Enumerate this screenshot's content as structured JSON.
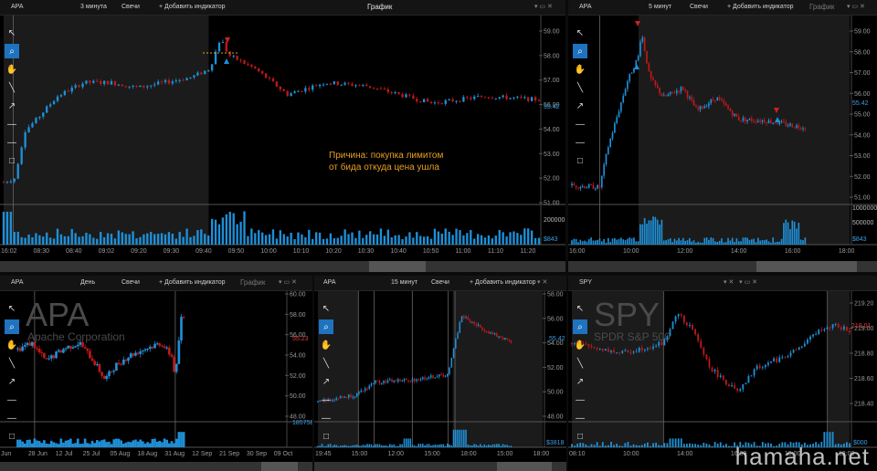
{
  "panels": {
    "p1": {
      "symbol": "APA",
      "interval": "3 минута",
      "ctype": "Свечи",
      "addind": "+ Добавить индикатор",
      "title": "График",
      "price": "55.42",
      "vol_label": "200000",
      "vol_last": "$843",
      "y": [
        "59.00",
        "58.00",
        "57.00",
        "56.00",
        "54.00",
        "53.00",
        "52.00",
        "51.00"
      ],
      "x": [
        "16:02",
        "08:30",
        "08:40",
        "09:02",
        "09:20",
        "09:30",
        "09:40",
        "09:50",
        "10:00",
        "10:10",
        "10:20",
        "10:30",
        "10:40",
        "10:50",
        "11:00",
        "11:10",
        "11:20"
      ]
    },
    "p2": {
      "symbol": "APA",
      "interval": "5 минут",
      "ctype": "Свечи",
      "addind": "+ Добавить индикатор",
      "title": "График",
      "price": "55.42",
      "vol_label": "1000000",
      "vol_label2": "500000",
      "vol_last": "$843",
      "y": [
        "59.00",
        "58.00",
        "57.00",
        "56.00",
        "55.00",
        "54.00",
        "53.00",
        "52.00",
        "51.00"
      ],
      "x": [
        "16:00",
        "10:00",
        "12:00",
        "14:00",
        "16:00",
        "18:00"
      ]
    },
    "p3": {
      "symbol": "APA",
      "interval": "День",
      "ctype": "Свечи",
      "addind": "+ Добавить индикатор",
      "title": "График",
      "big": "APA",
      "sub": "Apache Corporation",
      "price": "55.23",
      "vol_last": "1857586",
      "y": [
        "60.00",
        "58.00",
        "56.00",
        "54.00",
        "52.00",
        "50.00",
        "48.00"
      ],
      "x": [
        "Jun",
        "28 Jun",
        "12 Jul",
        "25 Jul",
        "05 Aug",
        "18 Aug",
        "31 Aug",
        "12 Sep",
        "21 Sep",
        "30 Sep",
        "09 Oct"
      ]
    },
    "p4": {
      "symbol": "APA",
      "interval": "15 минут",
      "ctype": "Свечи",
      "addind": "+ Добавить индикатор",
      "price": "55.42",
      "vol_last": "$3818",
      "y": [
        "58.00",
        "56.00",
        "54.00",
        "52.00",
        "50.00",
        "48.00"
      ],
      "x": [
        "19:45",
        "15:00",
        "12:00",
        "15:00",
        "18:00",
        "15:00",
        "18:00"
      ]
    },
    "p5": {
      "symbol": "SPY",
      "big": "SPY",
      "sub": "SPDR S&P 500",
      "price": "219.01",
      "vol_last": "$000",
      "y": [
        "219.20",
        "219.00",
        "218.80",
        "218.60",
        "218.40"
      ],
      "x": [
        "08:10",
        "10:00",
        "14:00",
        "16:00",
        "16:00",
        "12:00"
      ]
    }
  },
  "annotation": {
    "line1": "Причина: покупка лимитом",
    "line2": "от бида откуда цена ушла"
  },
  "watermark": "hamaha.net",
  "colors": {
    "up": "#1e90d8",
    "down": "#c01818",
    "volume": "#1e90d8",
    "accent": "#e8a020"
  },
  "icons": [
    "cursor-icon",
    "magnifier-icon",
    "hand-icon",
    "line-icon",
    "arrow-icon",
    "hline-icon",
    "hline2-icon",
    "rectangle-icon"
  ]
}
